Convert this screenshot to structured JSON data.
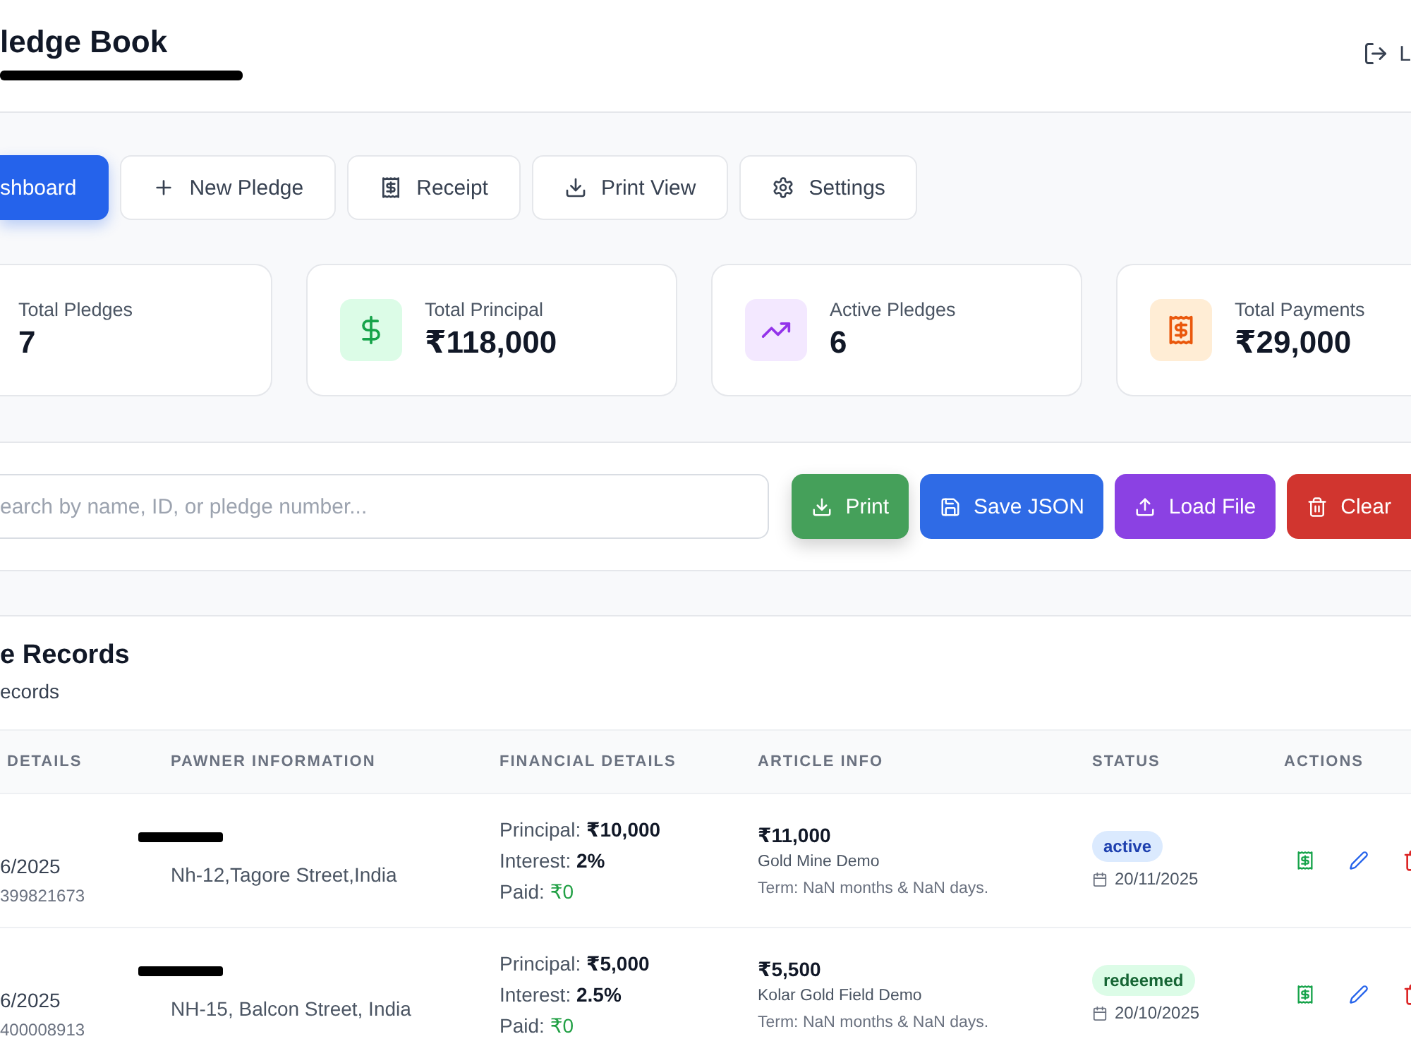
{
  "header": {
    "title": "ledge Book",
    "logout": "L"
  },
  "nav": [
    {
      "label": "shboard",
      "selected": true
    },
    {
      "label": "New Pledge",
      "selected": false
    },
    {
      "label": "Receipt",
      "selected": false
    },
    {
      "label": "Print View",
      "selected": false
    },
    {
      "label": "Settings",
      "selected": false
    }
  ],
  "stats": [
    {
      "label": "Total Pledges",
      "value": "7"
    },
    {
      "label": "Total Principal",
      "value": "₹118,000"
    },
    {
      "label": "Active Pledges",
      "value": "6"
    },
    {
      "label": "Total Payments",
      "value": "₹29,000"
    }
  ],
  "toolbar": {
    "search": {
      "placeholder": "earch by name, ID, or pledge number..."
    },
    "buttons": [
      {
        "label": "Print",
        "color": "#45a05a"
      },
      {
        "label": "Save JSON",
        "color": "#2f6be6"
      },
      {
        "label": "Load File",
        "color": "#8b41e3"
      },
      {
        "label": "Clear",
        "color": "#d1352f"
      }
    ]
  },
  "records": {
    "title": "e Records",
    "subtitle": "ecords",
    "columns": [
      "DETAILS",
      "PAWNER INFORMATION",
      "FINANCIAL DETAILS",
      "ARTICLE INFO",
      "STATUS",
      "ACTIONS"
    ],
    "rows": [
      {
        "date_text": "6/2025",
        "number": "399821673",
        "address": "Nh-12,Tagore Street,India",
        "financial": [
          {
            "kind": "principal",
            "label": "Principal:",
            "value": "₹10,000"
          },
          {
            "kind": "interest",
            "label": "Interest:",
            "value": "2%"
          },
          {
            "kind": "paid",
            "label": "Paid:",
            "value": "₹0"
          }
        ],
        "article": {
          "value": "₹11,000",
          "name": "Gold Mine Demo",
          "term": "Term: NaN months & NaN days."
        },
        "status": {
          "label": "active",
          "color": "#dbeafe"
        },
        "due_date": "20/11/2025"
      },
      {
        "date_text": "6/2025",
        "number": "400008913",
        "address": "NH-15, Balcon Street, India",
        "financial": [
          {
            "kind": "principal",
            "label": "Principal:",
            "value": "₹5,000"
          },
          {
            "kind": "interest",
            "label": "Interest:",
            "value": "2.5%"
          },
          {
            "kind": "paid",
            "label": "Paid:",
            "value": "₹0"
          }
        ],
        "article": {
          "value": "₹5,500",
          "name": "Kolar Gold Field Demo",
          "term": "Term: NaN months & NaN days."
        },
        "status": {
          "label": "redeemed",
          "color": "#dcfce7"
        },
        "due_date": "20/10/2025"
      }
    ]
  }
}
